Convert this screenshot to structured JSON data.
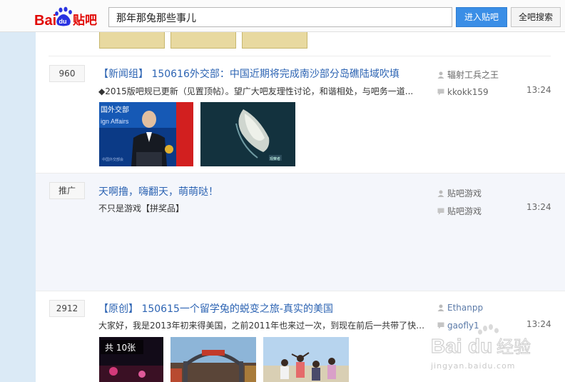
{
  "header": {
    "logo_text": "Baidu贴吧",
    "search_value": "那年那兔那些事儿",
    "enter_button": "进入贴吧",
    "all_search_button": "全吧搜索"
  },
  "posts": [
    {
      "count": "960",
      "title": "【新闻组】 150616外交部：中国近期将完成南沙部分岛礁陆域吹填",
      "excerpt": "◆2015版吧规已更新（见置顶帖）。望广大吧友理性讨论，和谐相处，与吧务一道...",
      "author": "辐射工兵之王",
      "last_reply_user": "kkokk159",
      "time": "13:24"
    },
    {
      "count": "推广",
      "title": "天啊撸，嗨翻天，萌萌哒！",
      "excerpt": "不只是游戏【拼奖品】",
      "author": "贴吧游戏",
      "last_reply_user": "贴吧游戏",
      "time": "13:24"
    },
    {
      "count": "2912",
      "title": "【原创】 150615一个留学兔的蜕变之旅-真实的美国",
      "excerpt": "大家好，我是2013年初来得美国，之前2011年也来过一次，到现在前后一共带了快3...",
      "author": "Ethanpp",
      "last_reply_user": "gaofly1",
      "time": "13:24",
      "image_badge": "共 10张"
    }
  ],
  "watermark": {
    "text": "Baidu经验",
    "url": "jingyan.baidu.com"
  },
  "colors": {
    "link_blue": "#2d64b3",
    "button_blue": "#3a8ee6",
    "baidu_red": "#e10602",
    "baidu_blue": "#2932e1"
  }
}
